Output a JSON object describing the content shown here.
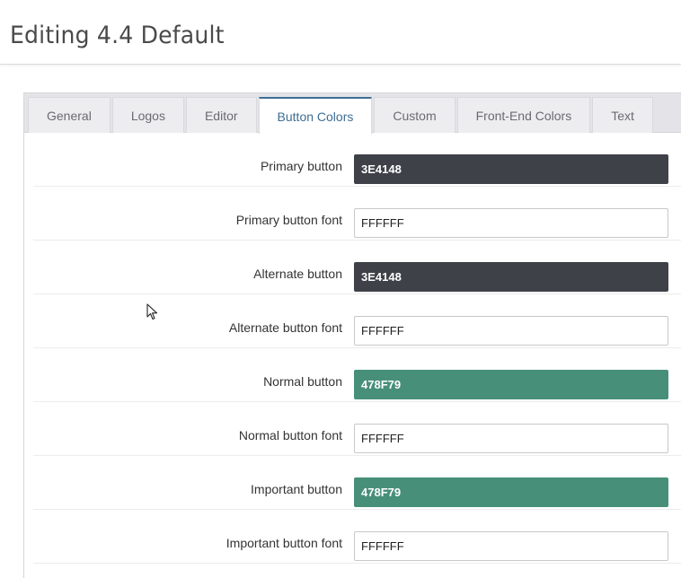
{
  "header": {
    "title": "Editing 4.4 Default"
  },
  "tabs": [
    {
      "label": "General",
      "active": false
    },
    {
      "label": "Logos",
      "active": false
    },
    {
      "label": "Editor",
      "active": false
    },
    {
      "label": "Button Colors",
      "active": true
    },
    {
      "label": "Custom",
      "active": false
    },
    {
      "label": "Front-End Colors",
      "active": false
    },
    {
      "label": "Text",
      "active": false
    }
  ],
  "fields": [
    {
      "label": "Primary button",
      "value": "3E4148",
      "color": "#3E4148",
      "dark": true
    },
    {
      "label": "Primary button font",
      "value": "FFFFFF",
      "color": "#FFFFFF",
      "dark": false
    },
    {
      "label": "Alternate button",
      "value": "3E4148",
      "color": "#3E4148",
      "dark": true
    },
    {
      "label": "Alternate button font",
      "value": "FFFFFF",
      "color": "#FFFFFF",
      "dark": false
    },
    {
      "label": "Normal button",
      "value": "478F79",
      "color": "#478F79",
      "dark": true
    },
    {
      "label": "Normal button font",
      "value": "FFFFFF",
      "color": "#FFFFFF",
      "dark": false
    },
    {
      "label": "Important button",
      "value": "478F79",
      "color": "#478F79",
      "dark": true
    },
    {
      "label": "Important button font",
      "value": "FFFFFF",
      "color": "#FFFFFF",
      "dark": false
    }
  ],
  "theme": {
    "accent": "#3d6e94"
  }
}
